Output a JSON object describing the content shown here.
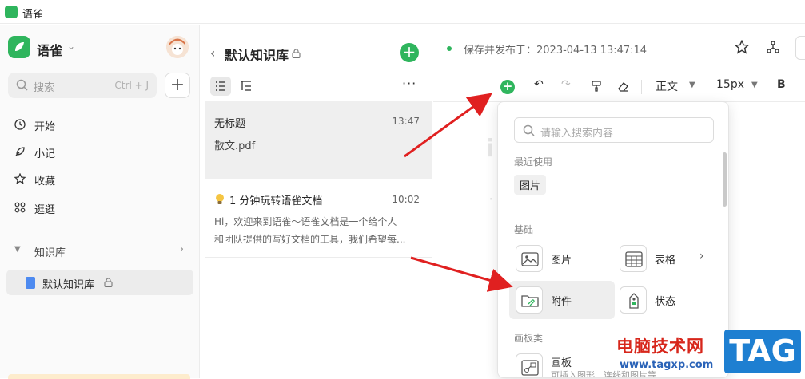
{
  "window": {
    "title": "语雀"
  },
  "sidebar": {
    "brand": "语雀",
    "search_placeholder": "搜索",
    "search_shortcut": "Ctrl + J",
    "nav": [
      {
        "label": "开始",
        "icon": "clock-icon"
      },
      {
        "label": "小记",
        "icon": "feather-icon"
      },
      {
        "label": "收藏",
        "icon": "star-icon"
      },
      {
        "label": "逛逛",
        "icon": "grid-icon"
      }
    ],
    "section_label": "知识库",
    "kb_item": "默认知识库"
  },
  "doclist": {
    "title": "默认知识库",
    "docs": [
      {
        "title": "无标题",
        "time": "13:47",
        "subtitle": "散文.pdf"
      },
      {
        "title": "1 分钟玩转语雀文档",
        "time": "10:02",
        "line1": "Hi，欢迎来到语雀～语雀文档是一个给个人",
        "line2": "和团队提供的写好文档的工具，我们希望每..."
      }
    ]
  },
  "editor": {
    "status": "保存并发布于：2023-04-13 13:47:14",
    "toolbar": {
      "style": "正文",
      "size": "15px",
      "bold": "B"
    }
  },
  "insert_menu": {
    "search_placeholder": "请输入搜索内容",
    "recent_heading": "最近使用",
    "recent_chip": "图片",
    "basic_heading": "基础",
    "items": [
      {
        "label": "图片",
        "icon": "image-icon"
      },
      {
        "label": "表格",
        "icon": "table-icon"
      },
      {
        "label": "附件",
        "icon": "folder-icon"
      },
      {
        "label": "状态",
        "icon": "tag-icon"
      }
    ],
    "board_heading": "画板类",
    "board_item": {
      "label": "画板",
      "sub": "可插入图形、连线和图片等"
    }
  },
  "colors": {
    "accent": "#2fb55d",
    "arrow": "#e02020"
  },
  "watermark": {
    "line1": "电脑技术网",
    "line2": "www.tagxp.com",
    "tag": "TAG"
  }
}
